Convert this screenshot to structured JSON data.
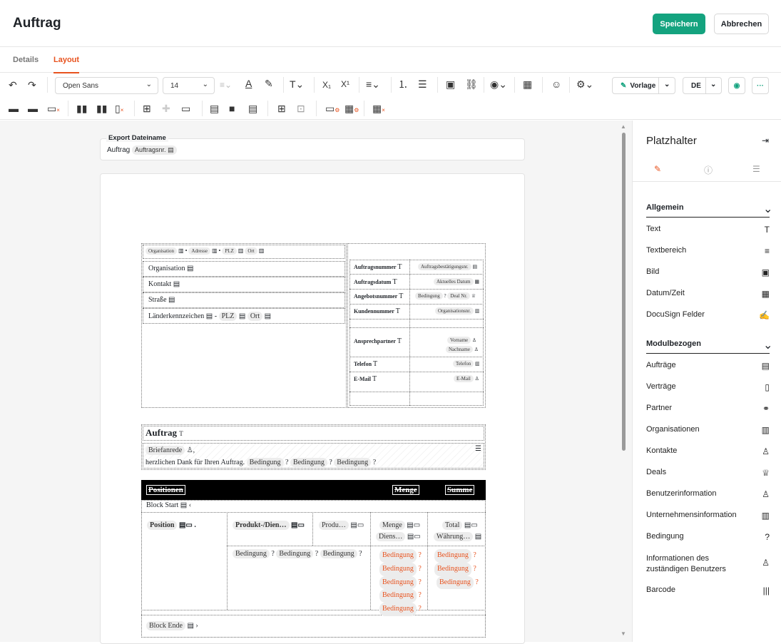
{
  "header": {
    "title": "Auftrag",
    "save": "Speichern",
    "cancel": "Abbrechen"
  },
  "tabs": [
    "Details",
    "Layout"
  ],
  "toolbar": {
    "font": "Open Sans",
    "size": "14",
    "vorlage": "Vorlage",
    "lang": "DE",
    "more": "···"
  },
  "export": {
    "label": "Export Dateiname",
    "prefix": "Auftrag",
    "chip": "Auftragsnr."
  },
  "address": {
    "line": [
      "Organisation",
      "Adresse",
      "PLZ",
      "Ort"
    ],
    "rows": [
      "Organisation",
      "Kontakt",
      "Straße"
    ],
    "last": [
      "Länderkennzeichen",
      "PLZ",
      "Ort"
    ]
  },
  "meta": {
    "rows": [
      {
        "label": "Auftragsnummer",
        "value": "Auftragsbestätigungsnr."
      },
      {
        "label": "Auftragsdatum",
        "value": "Aktuelles Datum"
      },
      {
        "label": "Angebotsnummer",
        "value": "Bedingung",
        "value2": "Deal Nr."
      },
      {
        "label": "Kundennummer",
        "value": "Organisationsnr."
      },
      {
        "label": "Ansprechpartner",
        "value": "Vorname",
        "value2": "Nachname"
      },
      {
        "label": "Telefon",
        "value": "Telefon"
      },
      {
        "label": "E-Mail",
        "value": "E-Mail"
      }
    ]
  },
  "body": {
    "heading": "Auftrag",
    "salutation": "Briefanrede",
    "thanks": "herzlichen Dank für Ihren Auftrag.",
    "cond": "Bedingung"
  },
  "table": {
    "head": [
      "Positionen",
      "Menge",
      "Summe"
    ],
    "block_start": "Block Start",
    "position": "Position",
    "product": "Produkt-/Dien…",
    "produ": "Produ…",
    "menge": "Menge",
    "diens": "Diens…",
    "total": "Total",
    "waehrung": "Währung…",
    "cond": "Bedingung",
    "block_end": "Block Ende"
  },
  "panel": {
    "title": "Platzhalter",
    "sections": [
      {
        "name": "Allgemein",
        "items": [
          [
            "Text",
            "T"
          ],
          [
            "Textbereich",
            "≡"
          ],
          [
            "Bild",
            "▣"
          ],
          [
            "Datum/Zeit",
            "▦"
          ],
          [
            "DocuSign Felder",
            "✍"
          ]
        ]
      },
      {
        "name": "Modulbezogen",
        "items": [
          [
            "Aufträge",
            "▤"
          ],
          [
            "Verträge",
            "▯"
          ],
          [
            "Partner",
            "⚭"
          ],
          [
            "Organisationen",
            "▥"
          ],
          [
            "Kontakte",
            "♙"
          ],
          [
            "Deals",
            "♕"
          ],
          [
            "Benutzerinformation",
            "♙"
          ],
          [
            "Unternehmensinformation",
            "▥"
          ],
          [
            "Bedingung",
            "?"
          ],
          [
            "Informationen des zuständigen Benutzers",
            "♙"
          ],
          [
            "Barcode",
            "|||"
          ]
        ]
      }
    ]
  }
}
